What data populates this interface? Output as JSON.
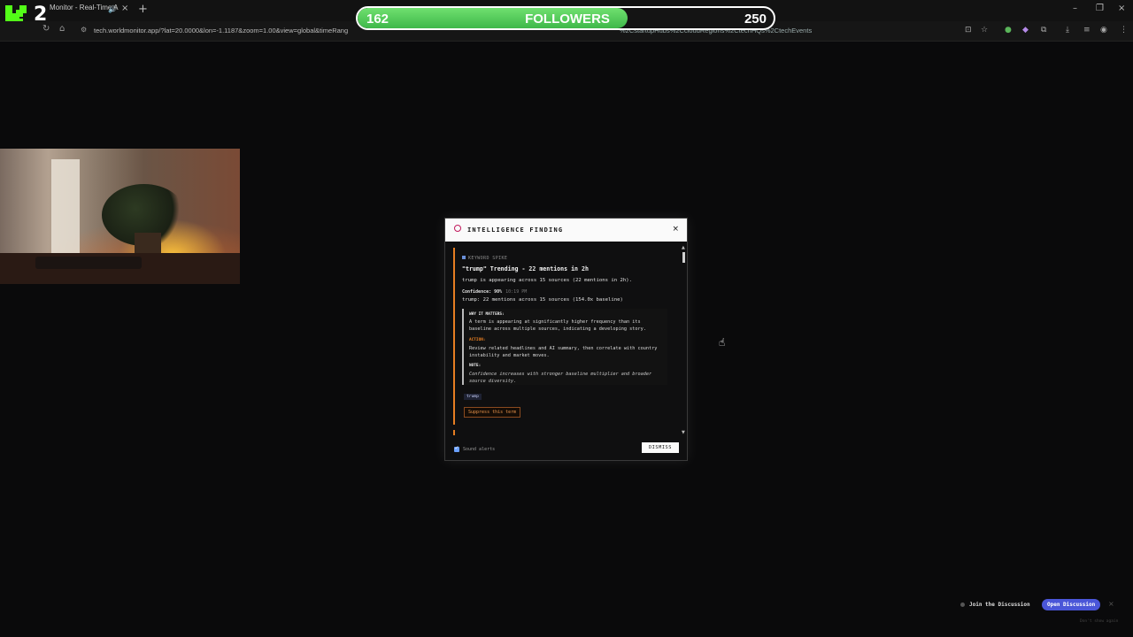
{
  "browser": {
    "tab_title": "Monitor - Real-Time A",
    "url": "tech.worldmonitor.app/?lat=20.0000&lon=-1.1187&zoom=1.00&view=global&timeRang",
    "url_tail": "%2CstartupHubs%2CcloudRegions%2CtechHQs%2CtechEvents"
  },
  "overlay": {
    "logo_letter": "K",
    "logo_number": "2",
    "followers_current": "162",
    "followers_label": "FOLLOWERS",
    "followers_goal": "250",
    "followers_progress": 0.648,
    "accent_green": "#4cc75a"
  },
  "modal": {
    "title": "INTELLIGENCE FINDING",
    "close_icon": "×",
    "finding": {
      "category": "KEYWORD SPIKE",
      "title": "\"trump\" Trending - 22 mentions in 2h",
      "description": "trump is appearing across 15 sources (22 mentions in 2h).",
      "confidence": "Confidence: 90%",
      "time": "10:19 PM",
      "stat": "trump: 22 mentions across 15 sources (154.0x baseline)",
      "why_label": "WHY IT MATTERS:",
      "why_text": "A term is appearing at significantly higher frequency than its baseline across multiple sources, indicating a developing story.",
      "action_label": "ACTION:",
      "action_text": "Review related headlines and AI summary, then correlate with country instability and market moves.",
      "note_label": "NOTE:",
      "note_text": "Confidence increases with stronger baseline multiplier and broader source diversity.",
      "tag": "trump",
      "suppress_label": "Suppress this term"
    },
    "sound_alerts_label": "Sound alerts",
    "sound_alerts_checked": true,
    "dismiss_label": "DISMISS"
  },
  "discussion": {
    "label": "Join the Discussion",
    "button": "Open Discussion",
    "close_icon": "×",
    "dont_show": "Don't show again"
  }
}
